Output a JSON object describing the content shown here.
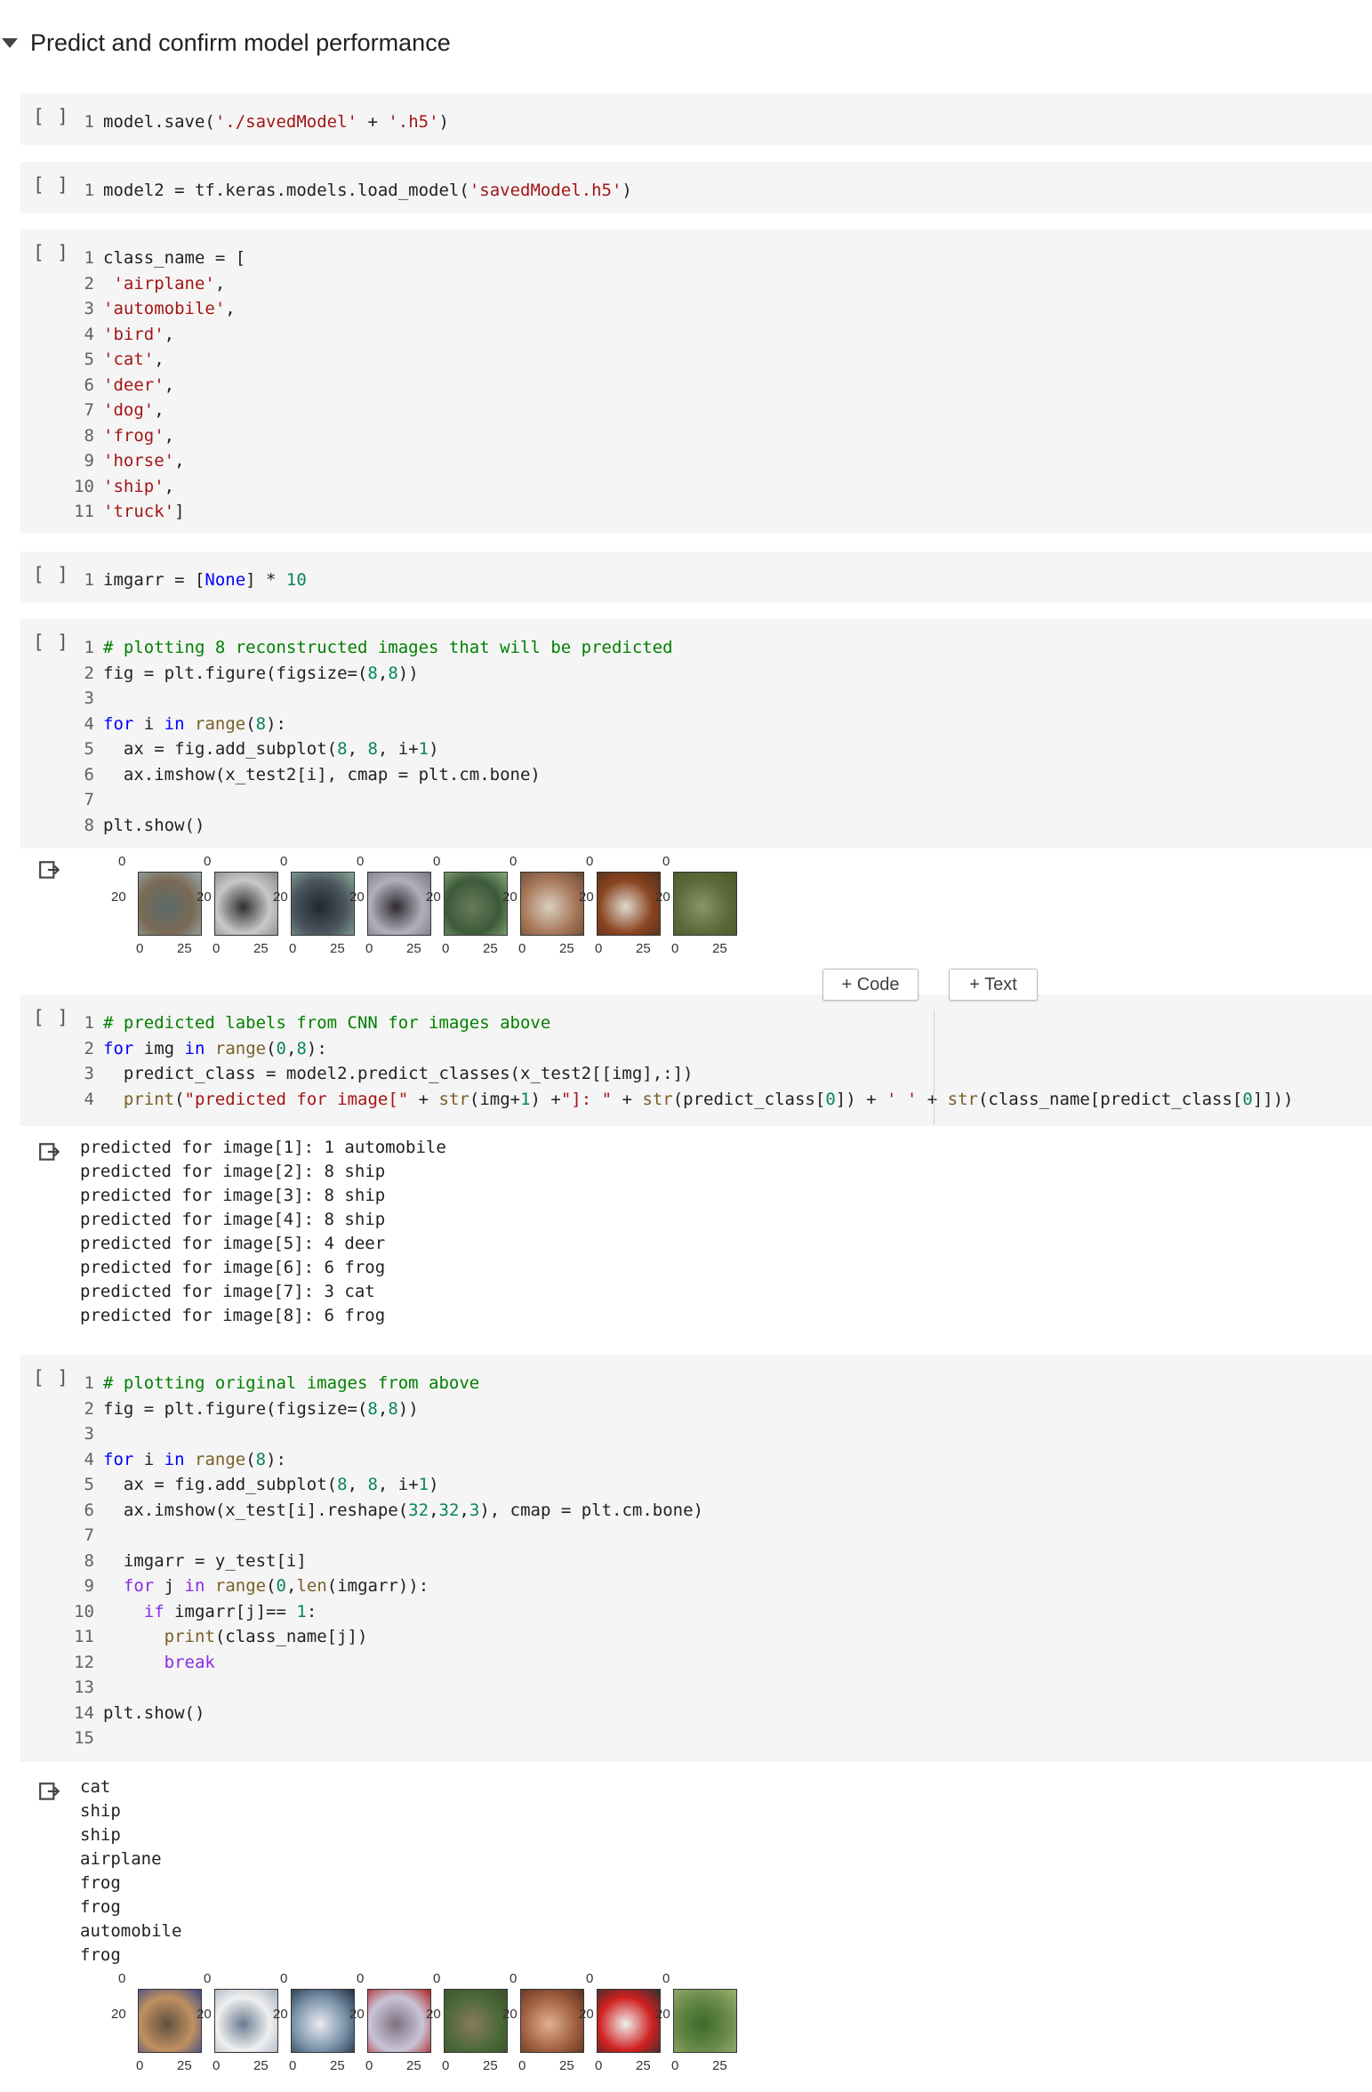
{
  "section": {
    "title": "Predict and confirm model performance"
  },
  "run_label": "[ ]",
  "toolbar": {
    "add_code": "+ Code",
    "add_text": "+ Text"
  },
  "cells": [
    {
      "lines": [
        [
          {
            "t": "model.save(",
            "c": ""
          },
          {
            "t": "'./savedModel'",
            "c": "str"
          },
          {
            "t": " + ",
            "c": ""
          },
          {
            "t": "'.h5'",
            "c": "str"
          },
          {
            "t": ")",
            "c": ""
          }
        ]
      ]
    },
    {
      "lines": [
        [
          {
            "t": "model2 = tf.keras.models.load_model(",
            "c": ""
          },
          {
            "t": "'savedModel.h5'",
            "c": "str"
          },
          {
            "t": ")",
            "c": ""
          }
        ]
      ]
    },
    {
      "lines": [
        [
          {
            "t": "class_name = [",
            "c": ""
          }
        ],
        [
          {
            "t": " ",
            "c": ""
          },
          {
            "t": "'airplane'",
            "c": "str"
          },
          {
            "t": ",",
            "c": ""
          }
        ],
        [
          {
            "t": "'automobile'",
            "c": "str"
          },
          {
            "t": ",",
            "c": ""
          }
        ],
        [
          {
            "t": "'bird'",
            "c": "str"
          },
          {
            "t": ",",
            "c": ""
          }
        ],
        [
          {
            "t": "'cat'",
            "c": "str"
          },
          {
            "t": ",",
            "c": ""
          }
        ],
        [
          {
            "t": "'deer'",
            "c": "str"
          },
          {
            "t": ",",
            "c": ""
          }
        ],
        [
          {
            "t": "'dog'",
            "c": "str"
          },
          {
            "t": ",",
            "c": ""
          }
        ],
        [
          {
            "t": "'frog'",
            "c": "str"
          },
          {
            "t": ",",
            "c": ""
          }
        ],
        [
          {
            "t": "'horse'",
            "c": "str"
          },
          {
            "t": ",",
            "c": ""
          }
        ],
        [
          {
            "t": "'ship'",
            "c": "str"
          },
          {
            "t": ",",
            "c": ""
          }
        ],
        [
          {
            "t": "'truck'",
            "c": "str"
          },
          {
            "t": "]",
            "c": ""
          }
        ]
      ]
    },
    {
      "lines": [
        [
          {
            "t": "imgarr = [",
            "c": ""
          },
          {
            "t": "None",
            "c": "kw2"
          },
          {
            "t": "] * ",
            "c": ""
          },
          {
            "t": "10",
            "c": "num"
          }
        ]
      ]
    },
    {
      "lines": [
        [
          {
            "t": "# plotting 8 reconstructed images that will be predicted",
            "c": "com"
          }
        ],
        [
          {
            "t": "fig = plt.figure(figsize=(",
            "c": ""
          },
          {
            "t": "8",
            "c": "num"
          },
          {
            "t": ",",
            "c": ""
          },
          {
            "t": "8",
            "c": "num"
          },
          {
            "t": "))",
            "c": ""
          }
        ],
        [
          {
            "t": "",
            "c": ""
          }
        ],
        [
          {
            "t": "for",
            "c": "kw2"
          },
          {
            "t": " i ",
            "c": ""
          },
          {
            "t": "in",
            "c": "kw2"
          },
          {
            "t": " ",
            "c": ""
          },
          {
            "t": "range",
            "c": "fn"
          },
          {
            "t": "(",
            "c": ""
          },
          {
            "t": "8",
            "c": "num"
          },
          {
            "t": "):",
            "c": ""
          }
        ],
        [
          {
            "t": "  ax = fig.add_subplot(",
            "c": ""
          },
          {
            "t": "8",
            "c": "num"
          },
          {
            "t": ", ",
            "c": ""
          },
          {
            "t": "8",
            "c": "num"
          },
          {
            "t": ", i+",
            "c": ""
          },
          {
            "t": "1",
            "c": "num"
          },
          {
            "t": ")",
            "c": ""
          }
        ],
        [
          {
            "t": "  ax.imshow(x_test2[i], cmap = plt.cm.bone)",
            "c": ""
          }
        ],
        [
          {
            "t": "",
            "c": ""
          }
        ],
        [
          {
            "t": "plt.show()",
            "c": ""
          }
        ]
      ]
    },
    {
      "lines": [
        [
          {
            "t": "# predicted labels from CNN for images above",
            "c": "com"
          }
        ],
        [
          {
            "t": "for",
            "c": "kw2"
          },
          {
            "t": " img ",
            "c": ""
          },
          {
            "t": "in",
            "c": "kw2"
          },
          {
            "t": " ",
            "c": ""
          },
          {
            "t": "range",
            "c": "fn"
          },
          {
            "t": "(",
            "c": ""
          },
          {
            "t": "0",
            "c": "num"
          },
          {
            "t": ",",
            "c": ""
          },
          {
            "t": "8",
            "c": "num"
          },
          {
            "t": "):",
            "c": ""
          }
        ],
        [
          {
            "t": "  predict_class = model2.predict_classes(x_test2[[img],:])",
            "c": ""
          }
        ],
        [
          {
            "t": "  ",
            "c": ""
          },
          {
            "t": "print",
            "c": "fn"
          },
          {
            "t": "(",
            "c": ""
          },
          {
            "t": "\"predicted for image[\"",
            "c": "str"
          },
          {
            "t": " + ",
            "c": ""
          },
          {
            "t": "str",
            "c": "fn"
          },
          {
            "t": "(img+",
            "c": ""
          },
          {
            "t": "1",
            "c": "num"
          },
          {
            "t": ") +",
            "c": ""
          },
          {
            "t": "\"]: \"",
            "c": "str"
          },
          {
            "t": " + ",
            "c": ""
          },
          {
            "t": "str",
            "c": "fn"
          },
          {
            "t": "(predict_class[",
            "c": ""
          },
          {
            "t": "0",
            "c": "num"
          },
          {
            "t": "]) + ",
            "c": ""
          },
          {
            "t": "' '",
            "c": "str"
          },
          {
            "t": " + ",
            "c": ""
          },
          {
            "t": "str",
            "c": "fn"
          },
          {
            "t": "(class_name[predict_class[",
            "c": ""
          },
          {
            "t": "0",
            "c": "num"
          },
          {
            "t": "]]))",
            "c": ""
          }
        ]
      ]
    },
    {
      "lines": [
        [
          {
            "t": "# plotting original images from above",
            "c": "com"
          }
        ],
        [
          {
            "t": "fig = plt.figure(figsize=(",
            "c": ""
          },
          {
            "t": "8",
            "c": "num"
          },
          {
            "t": ",",
            "c": ""
          },
          {
            "t": "8",
            "c": "num"
          },
          {
            "t": "))",
            "c": ""
          }
        ],
        [
          {
            "t": "",
            "c": ""
          }
        ],
        [
          {
            "t": "for",
            "c": "kw2"
          },
          {
            "t": " i ",
            "c": ""
          },
          {
            "t": "in",
            "c": "kw2"
          },
          {
            "t": " ",
            "c": ""
          },
          {
            "t": "range",
            "c": "fn"
          },
          {
            "t": "(",
            "c": ""
          },
          {
            "t": "8",
            "c": "num"
          },
          {
            "t": "):",
            "c": ""
          }
        ],
        [
          {
            "t": "  ax = fig.add_subplot(",
            "c": ""
          },
          {
            "t": "8",
            "c": "num"
          },
          {
            "t": ", ",
            "c": ""
          },
          {
            "t": "8",
            "c": "num"
          },
          {
            "t": ", i+",
            "c": ""
          },
          {
            "t": "1",
            "c": "num"
          },
          {
            "t": ")",
            "c": ""
          }
        ],
        [
          {
            "t": "  ax.imshow(x_test[i].reshape(",
            "c": ""
          },
          {
            "t": "32",
            "c": "num"
          },
          {
            "t": ",",
            "c": ""
          },
          {
            "t": "32",
            "c": "num"
          },
          {
            "t": ",",
            "c": ""
          },
          {
            "t": "3",
            "c": "num"
          },
          {
            "t": "), cmap = plt.cm.bone)",
            "c": ""
          }
        ],
        [
          {
            "t": "",
            "c": ""
          }
        ],
        [
          {
            "t": "  imgarr = y_test[i]",
            "c": ""
          }
        ],
        [
          {
            "t": "  ",
            "c": ""
          },
          {
            "t": "for",
            "c": "kw"
          },
          {
            "t": " j ",
            "c": ""
          },
          {
            "t": "in",
            "c": "kw"
          },
          {
            "t": " ",
            "c": ""
          },
          {
            "t": "range",
            "c": "fn"
          },
          {
            "t": "(",
            "c": ""
          },
          {
            "t": "0",
            "c": "num"
          },
          {
            "t": ",",
            "c": ""
          },
          {
            "t": "len",
            "c": "fn"
          },
          {
            "t": "(imgarr)):",
            "c": ""
          }
        ],
        [
          {
            "t": "    ",
            "c": ""
          },
          {
            "t": "if",
            "c": "kw"
          },
          {
            "t": " imgarr[j]== ",
            "c": ""
          },
          {
            "t": "1",
            "c": "num"
          },
          {
            "t": ":",
            "c": ""
          }
        ],
        [
          {
            "t": "      ",
            "c": ""
          },
          {
            "t": "print",
            "c": "fn"
          },
          {
            "t": "(class_name[j])",
            "c": ""
          }
        ],
        [
          {
            "t": "      ",
            "c": ""
          },
          {
            "t": "break",
            "c": "kw"
          }
        ],
        [
          {
            "t": "",
            "c": ""
          }
        ],
        [
          {
            "t": "plt.show()",
            "c": ""
          }
        ],
        [
          {
            "t": "",
            "c": ""
          }
        ]
      ]
    }
  ],
  "outputs": {
    "predictions": [
      "predicted for image[1]: 1 automobile",
      "predicted for image[2]: 8 ship",
      "predicted for image[3]: 8 ship",
      "predicted for image[4]: 8 ship",
      "predicted for image[5]: 4 deer",
      "predicted for image[6]: 6 frog",
      "predicted for image[7]: 3 cat",
      "predicted for image[8]: 6 frog"
    ],
    "originals": [
      "cat",
      "ship",
      "ship",
      "airplane",
      "frog",
      "frog",
      "automobile",
      "frog"
    ]
  },
  "plot_ticks": {
    "y_top": "0",
    "y_mid": "20",
    "x_left": "0",
    "x_right": "25"
  },
  "thumbs_reconstructed": [
    [
      "#7a6a55",
      "#5a6a6a",
      "#9aa"
    ],
    [
      "#c8c8c8",
      "#303030",
      "#888"
    ],
    [
      "#4c5660",
      "#20282e",
      "#8a9"
    ],
    [
      "#b0b0bc",
      "#302a30",
      "#778"
    ],
    [
      "#3c5a3a",
      "#6a7a5a",
      "#8a7"
    ],
    [
      "#a8785a",
      "#d8d0c0",
      "#6a4a34"
    ],
    [
      "#8a4420",
      "#e0dad0",
      "#50301a"
    ],
    [
      "#5c6a3a",
      "#8a946a",
      "#4a5a2a"
    ]
  ],
  "thumbs_original": [
    [
      "#c09060",
      "#605040",
      "#3c4a8a"
    ],
    [
      "#f0f0f0",
      "#6a7c90",
      "#a4b0c0"
    ],
    [
      "#7890a8",
      "#e8ecf0",
      "#203040"
    ],
    [
      "#c8c4d8",
      "#807080",
      "#b02020"
    ],
    [
      "#4c6a3a",
      "#8a7a5a",
      "#3a5028"
    ],
    [
      "#a06040",
      "#e0b090",
      "#5a3020"
    ],
    [
      "#d02020",
      "#f0f0f0",
      "#303030"
    ],
    [
      "#6a8a4a",
      "#3a6a2a",
      "#9ab070"
    ]
  ]
}
